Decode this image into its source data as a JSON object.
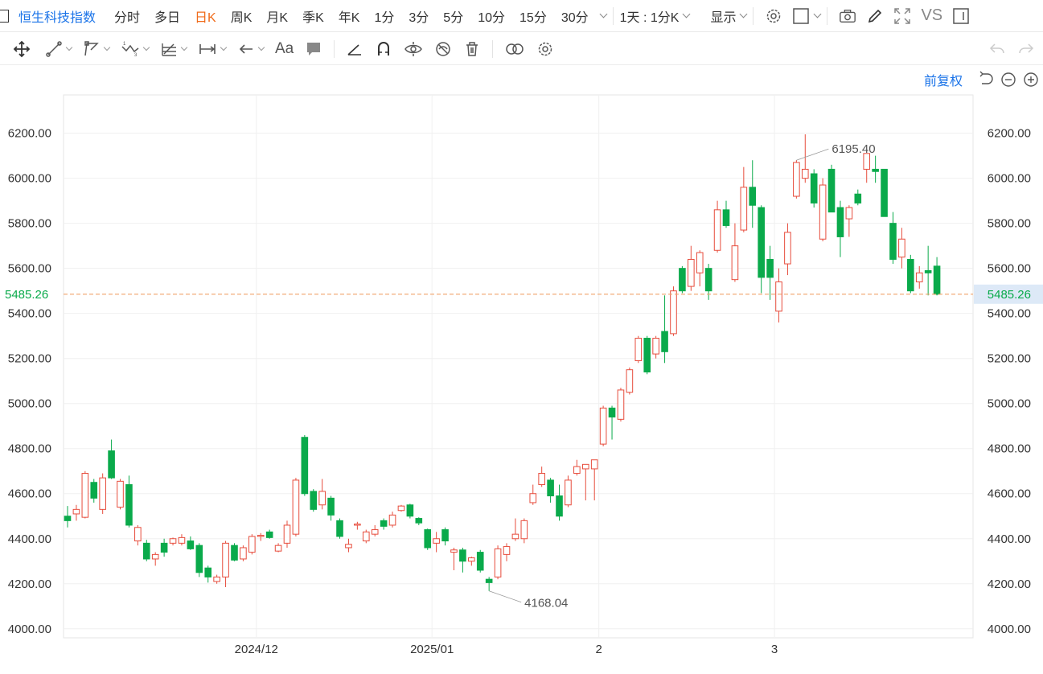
{
  "toolbar": {
    "title": "恒生科技指数",
    "periods": [
      "分时",
      "多日",
      "日K",
      "周K",
      "月K",
      "季K",
      "年K",
      "1分",
      "3分",
      "5分",
      "10分",
      "15分",
      "30分"
    ],
    "active_period": "日K",
    "range_select": "1天 : 1分K",
    "display_label": "显示",
    "vs_label": "VS"
  },
  "toolbar2": {
    "tools": [
      "move-icon",
      "line-tool-icon",
      "polyline-tool-icon",
      "wave-tool-icon",
      "fib-tool-icon",
      "measure-tool-icon",
      "arrow-tool-icon",
      "text-tool-icon",
      "comment-tool-icon",
      "ruler-icon",
      "magnet-icon",
      "eye-lock-icon",
      "hide-icon",
      "trash-icon",
      "compare-icon",
      "settings-icon",
      "undo-icon",
      "redo-icon"
    ]
  },
  "adjust_label": "前复权",
  "colors": {
    "up": "#e74c3c",
    "down": "#0aaa4b",
    "accent": "#1a73e8",
    "active": "#f06b1a",
    "price_line": "#f0a36a",
    "price_tag_bg": "#dde9f7",
    "price_tag_text": "#0aaa4b"
  },
  "chart_data": {
    "type": "candlestick",
    "ylim": [
      3960,
      6370
    ],
    "y_ticks": [
      "6200.00",
      "6000.00",
      "5800.00",
      "5600.00",
      "5400.00",
      "5200.00",
      "5000.00",
      "4800.00",
      "4600.00",
      "4400.00",
      "4200.00",
      "4000.00"
    ],
    "x_ticks": [
      {
        "label": "2024/12",
        "index": 21
      },
      {
        "label": "2025/01",
        "index": 41
      },
      {
        "label": "2",
        "index": 60
      },
      {
        "label": "3",
        "index": 80
      }
    ],
    "current_price": "5485.26",
    "high_label": "6195.40",
    "high_index": 83,
    "low_label": "4168.04",
    "low_index": 48,
    "candles": [
      {
        "o": 4500,
        "h": 4545,
        "l": 4450,
        "c": 4480
      },
      {
        "o": 4510,
        "h": 4550,
        "l": 4480,
        "c": 4530
      },
      {
        "o": 4495,
        "h": 4700,
        "l": 4490,
        "c": 4690
      },
      {
        "o": 4650,
        "h": 4665,
        "l": 4560,
        "c": 4580
      },
      {
        "o": 4530,
        "h": 4690,
        "l": 4510,
        "c": 4670
      },
      {
        "o": 4790,
        "h": 4840,
        "l": 4665,
        "c": 4670
      },
      {
        "o": 4540,
        "h": 4665,
        "l": 4530,
        "c": 4655
      },
      {
        "o": 4640,
        "h": 4680,
        "l": 4450,
        "c": 4460
      },
      {
        "o": 4390,
        "h": 4460,
        "l": 4370,
        "c": 4450
      },
      {
        "o": 4380,
        "h": 4395,
        "l": 4300,
        "c": 4310
      },
      {
        "o": 4310,
        "h": 4340,
        "l": 4280,
        "c": 4330
      },
      {
        "o": 4380,
        "h": 4400,
        "l": 4320,
        "c": 4340
      },
      {
        "o": 4380,
        "h": 4405,
        "l": 4370,
        "c": 4400
      },
      {
        "o": 4380,
        "h": 4420,
        "l": 4370,
        "c": 4405
      },
      {
        "o": 4390,
        "h": 4410,
        "l": 4350,
        "c": 4355
      },
      {
        "o": 4370,
        "h": 4380,
        "l": 4230,
        "c": 4250
      },
      {
        "o": 4270,
        "h": 4280,
        "l": 4205,
        "c": 4230
      },
      {
        "o": 4210,
        "h": 4240,
        "l": 4200,
        "c": 4230
      },
      {
        "o": 4230,
        "h": 4390,
        "l": 4185,
        "c": 4380
      },
      {
        "o": 4370,
        "h": 4380,
        "l": 4300,
        "c": 4305
      },
      {
        "o": 4310,
        "h": 4370,
        "l": 4300,
        "c": 4360
      },
      {
        "o": 4340,
        "h": 4420,
        "l": 4330,
        "c": 4410
      },
      {
        "o": 4410,
        "h": 4425,
        "l": 4390,
        "c": 4415
      },
      {
        "o": 4430,
        "h": 4440,
        "l": 4400,
        "c": 4405
      },
      {
        "o": 4345,
        "h": 4380,
        "l": 4340,
        "c": 4370
      },
      {
        "o": 4380,
        "h": 4480,
        "l": 4360,
        "c": 4460
      },
      {
        "o": 4420,
        "h": 4670,
        "l": 4410,
        "c": 4660
      },
      {
        "o": 4850,
        "h": 4860,
        "l": 4590,
        "c": 4600
      },
      {
        "o": 4610,
        "h": 4620,
        "l": 4520,
        "c": 4530
      },
      {
        "o": 4550,
        "h": 4665,
        "l": 4530,
        "c": 4610
      },
      {
        "o": 4580,
        "h": 4590,
        "l": 4480,
        "c": 4505
      },
      {
        "o": 4480,
        "h": 4490,
        "l": 4400,
        "c": 4410
      },
      {
        "o": 4360,
        "h": 4400,
        "l": 4340,
        "c": 4375
      },
      {
        "o": 4460,
        "h": 4475,
        "l": 4440,
        "c": 4465
      },
      {
        "o": 4390,
        "h": 4440,
        "l": 4380,
        "c": 4430
      },
      {
        "o": 4420,
        "h": 4460,
        "l": 4410,
        "c": 4440
      },
      {
        "o": 4480,
        "h": 4490,
        "l": 4440,
        "c": 4455
      },
      {
        "o": 4460,
        "h": 4520,
        "l": 4450,
        "c": 4505
      },
      {
        "o": 4525,
        "h": 4550,
        "l": 4520,
        "c": 4545
      },
      {
        "o": 4550,
        "h": 4555,
        "l": 4490,
        "c": 4500
      },
      {
        "o": 4490,
        "h": 4495,
        "l": 4460,
        "c": 4470
      },
      {
        "o": 4440,
        "h": 4445,
        "l": 4350,
        "c": 4360
      },
      {
        "o": 4380,
        "h": 4430,
        "l": 4340,
        "c": 4400
      },
      {
        "o": 4440,
        "h": 4450,
        "l": 4370,
        "c": 4390
      },
      {
        "o": 4340,
        "h": 4360,
        "l": 4260,
        "c": 4350
      },
      {
        "o": 4350,
        "h": 4360,
        "l": 4250,
        "c": 4300
      },
      {
        "o": 4300,
        "h": 4320,
        "l": 4280,
        "c": 4315
      },
      {
        "o": 4340,
        "h": 4350,
        "l": 4250,
        "c": 4260
      },
      {
        "o": 4220,
        "h": 4230,
        "l": 4168,
        "c": 4205
      },
      {
        "o": 4230,
        "h": 4370,
        "l": 4220,
        "c": 4355
      },
      {
        "o": 4330,
        "h": 4380,
        "l": 4300,
        "c": 4365
      },
      {
        "o": 4400,
        "h": 4490,
        "l": 4390,
        "c": 4420
      },
      {
        "o": 4400,
        "h": 4490,
        "l": 4380,
        "c": 4480
      },
      {
        "o": 4560,
        "h": 4640,
        "l": 4550,
        "c": 4600
      },
      {
        "o": 4640,
        "h": 4720,
        "l": 4630,
        "c": 4690
      },
      {
        "o": 4660,
        "h": 4670,
        "l": 4560,
        "c": 4590
      },
      {
        "o": 4590,
        "h": 4640,
        "l": 4480,
        "c": 4500
      },
      {
        "o": 4550,
        "h": 4680,
        "l": 4540,
        "c": 4660
      },
      {
        "o": 4690,
        "h": 4750,
        "l": 4680,
        "c": 4720
      },
      {
        "o": 4710,
        "h": 4730,
        "l": 4570,
        "c": 4730
      },
      {
        "o": 4710,
        "h": 4750,
        "l": 4570,
        "c": 4750
      },
      {
        "o": 4820,
        "h": 4990,
        "l": 4810,
        "c": 4980
      },
      {
        "o": 4980,
        "h": 4990,
        "l": 4840,
        "c": 4940
      },
      {
        "o": 4930,
        "h": 5070,
        "l": 4920,
        "c": 5060
      },
      {
        "o": 5050,
        "h": 5160,
        "l": 5040,
        "c": 5150
      },
      {
        "o": 5190,
        "h": 5300,
        "l": 5180,
        "c": 5290
      },
      {
        "o": 5290,
        "h": 5300,
        "l": 5130,
        "c": 5140
      },
      {
        "o": 5220,
        "h": 5300,
        "l": 5200,
        "c": 5290
      },
      {
        "o": 5320,
        "h": 5480,
        "l": 5180,
        "c": 5230
      },
      {
        "o": 5310,
        "h": 5520,
        "l": 5300,
        "c": 5500
      },
      {
        "o": 5600,
        "h": 5610,
        "l": 5490,
        "c": 5500
      },
      {
        "o": 5520,
        "h": 5700,
        "l": 5500,
        "c": 5640
      },
      {
        "o": 5580,
        "h": 5680,
        "l": 5520,
        "c": 5670
      },
      {
        "o": 5600,
        "h": 5620,
        "l": 5460,
        "c": 5500
      },
      {
        "o": 5680,
        "h": 5900,
        "l": 5670,
        "c": 5860
      },
      {
        "o": 5860,
        "h": 5900,
        "l": 5780,
        "c": 5790
      },
      {
        "o": 5550,
        "h": 5800,
        "l": 5540,
        "c": 5700
      },
      {
        "o": 5770,
        "h": 6050,
        "l": 5760,
        "c": 5960
      },
      {
        "o": 5960,
        "h": 6080,
        "l": 5780,
        "c": 5880
      },
      {
        "o": 5870,
        "h": 5880,
        "l": 5490,
        "c": 5560
      },
      {
        "o": 5640,
        "h": 5700,
        "l": 5460,
        "c": 5560
      },
      {
        "o": 5410,
        "h": 5600,
        "l": 5360,
        "c": 5540
      },
      {
        "o": 5620,
        "h": 5800,
        "l": 5570,
        "c": 5760
      },
      {
        "o": 5920,
        "h": 6080,
        "l": 5910,
        "c": 6070
      },
      {
        "o": 6000,
        "h": 6195,
        "l": 5980,
        "c": 6040
      },
      {
        "o": 6020,
        "h": 6040,
        "l": 5870,
        "c": 5890
      },
      {
        "o": 5730,
        "h": 6000,
        "l": 5720,
        "c": 5970
      },
      {
        "o": 6040,
        "h": 6060,
        "l": 5850,
        "c": 5850
      },
      {
        "o": 5870,
        "h": 5900,
        "l": 5650,
        "c": 5740
      },
      {
        "o": 5820,
        "h": 5880,
        "l": 5740,
        "c": 5870
      },
      {
        "o": 5930,
        "h": 5950,
        "l": 5880,
        "c": 5890
      },
      {
        "o": 6040,
        "h": 6110,
        "l": 5980,
        "c": 6110
      },
      {
        "o": 6040,
        "h": 6100,
        "l": 5980,
        "c": 6030
      },
      {
        "o": 6040,
        "h": 6040,
        "l": 5830,
        "c": 5830
      },
      {
        "o": 5800,
        "h": 5850,
        "l": 5620,
        "c": 5640
      },
      {
        "o": 5650,
        "h": 5780,
        "l": 5600,
        "c": 5730
      },
      {
        "o": 5640,
        "h": 5660,
        "l": 5490,
        "c": 5500
      },
      {
        "o": 5540,
        "h": 5610,
        "l": 5510,
        "c": 5580
      },
      {
        "o": 5590,
        "h": 5700,
        "l": 5480,
        "c": 5580
      },
      {
        "o": 5610,
        "h": 5650,
        "l": 5480,
        "c": 5485
      }
    ]
  }
}
